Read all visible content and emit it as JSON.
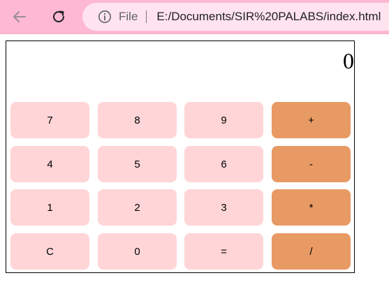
{
  "browser": {
    "site_info_label": "File",
    "url": "E:/Documents/SIR%20PALABS/index.html",
    "icons": {
      "back": "back-arrow-icon",
      "reload": "reload-icon",
      "info": "info-icon"
    }
  },
  "colors": {
    "toolbar": "#ffb8d2",
    "addressbar": "#ffe3ee",
    "number_key": "#ffd5d8",
    "operator_key": "#e89a64"
  },
  "calculator": {
    "display": "0",
    "keys": {
      "k7": "7",
      "k8": "8",
      "k9": "9",
      "plus": "+",
      "k4": "4",
      "k5": "5",
      "k6": "6",
      "minus": "-",
      "k1": "1",
      "k2": "2",
      "k3": "3",
      "multiply": "*",
      "clear": "C",
      "k0": "0",
      "equals": "=",
      "divide": "/"
    }
  }
}
